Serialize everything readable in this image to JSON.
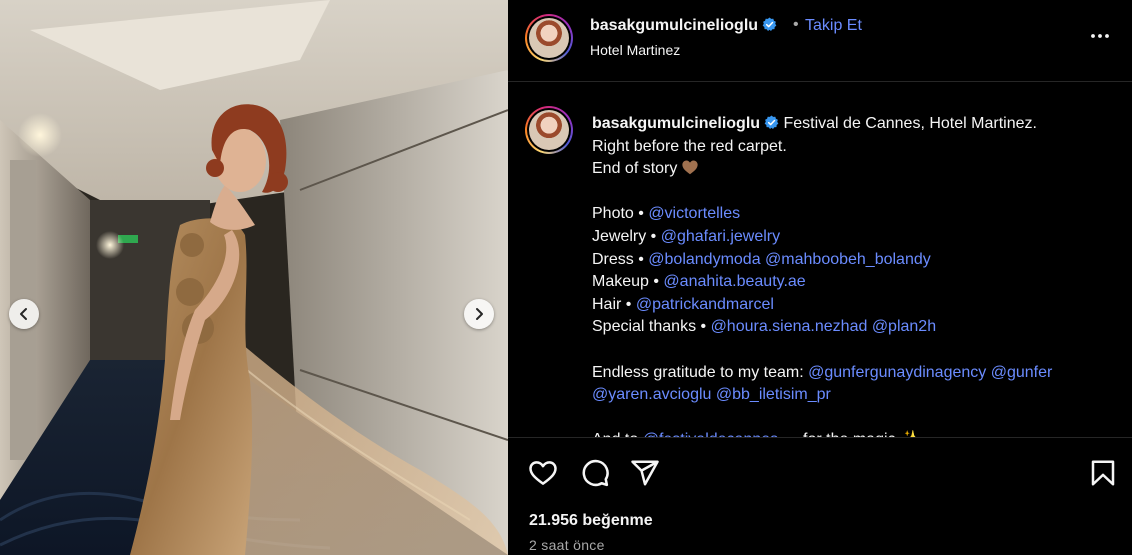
{
  "post": {
    "username": "basakgumulcinelioglu",
    "follow_label": "Takip Et",
    "separator": "•",
    "location": "Hotel Martinez",
    "caption_lines": [
      [
        {
          "t": "Festival de Cannes, Hotel Martinez.",
          "m": false
        }
      ],
      [
        {
          "t": "Right before the red carpet.",
          "m": false
        }
      ],
      [
        {
          "t": "End of story",
          "m": false
        }
      ],
      [],
      [
        {
          "t": "Photo • ",
          "m": false
        },
        {
          "t": "@victortelles",
          "m": true
        }
      ],
      [
        {
          "t": "Jewelry • ",
          "m": false
        },
        {
          "t": "@ghafari.jewelry",
          "m": true
        }
      ],
      [
        {
          "t": "Dress • ",
          "m": false
        },
        {
          "t": "@bolandymoda",
          "m": true
        },
        {
          "t": " ",
          "m": false
        },
        {
          "t": "@mahboobeh_bolandy",
          "m": true
        }
      ],
      [
        {
          "t": "Makeup • ",
          "m": false
        },
        {
          "t": "@anahita.beauty.ae",
          "m": true
        }
      ],
      [
        {
          "t": "Hair • ",
          "m": false
        },
        {
          "t": "@patrickandmarcel",
          "m": true
        }
      ],
      [
        {
          "t": "Special thanks • ",
          "m": false
        },
        {
          "t": "@houra.siena.nezhad",
          "m": true
        },
        {
          "t": " ",
          "m": false
        },
        {
          "t": "@plan2h",
          "m": true
        }
      ],
      [],
      [
        {
          "t": "Endless gratitude to my team: ",
          "m": false
        },
        {
          "t": "@gunfergunaydinagency",
          "m": true
        },
        {
          "t": " ",
          "m": false
        },
        {
          "t": "@gunfer",
          "m": true
        }
      ],
      [
        {
          "t": "@yaren.avcioglu",
          "m": true
        },
        {
          "t": " ",
          "m": false
        },
        {
          "t": "@bb_iletisim_pr",
          "m": true
        }
      ],
      [],
      [
        {
          "t": "And to ",
          "m": false
        },
        {
          "t": "@festivaldecannes",
          "m": true
        },
        {
          "t": " … for the magic ✨",
          "m": false
        }
      ]
    ],
    "likes": "21.956 beğenme",
    "time_ago": "2 saat önce"
  },
  "icons": {
    "verified": "verified-badge-icon",
    "more": "more-options-icon",
    "like": "heart-icon",
    "comment": "comment-icon",
    "share": "share-icon",
    "save": "bookmark-icon",
    "prev": "chevron-left-icon",
    "next": "chevron-right-icon",
    "emoji": "brown-heart-emoji"
  },
  "colors": {
    "link": "#6b8cff",
    "verified": "#3897f0",
    "secondary_text": "#a8a8a8",
    "divider": "#262626"
  }
}
